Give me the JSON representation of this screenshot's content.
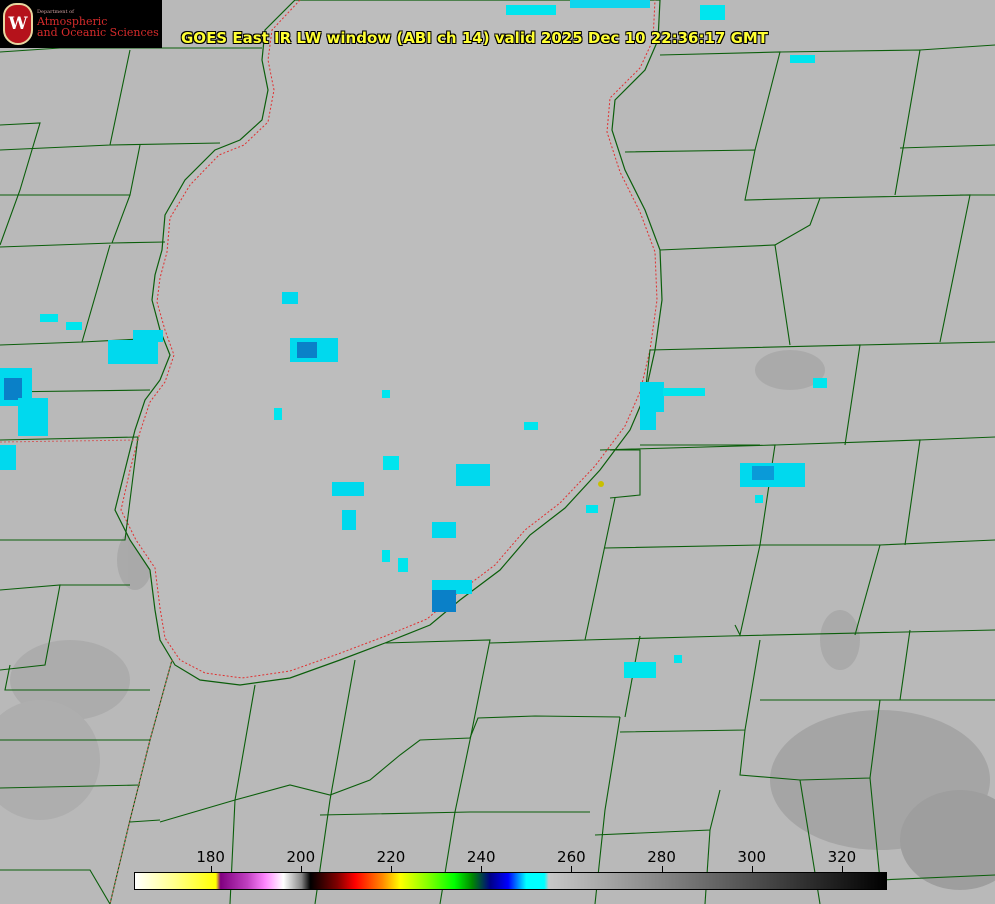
{
  "title": "GOES East IR LW window (ABI ch 14) valid 2025 Dec 10 22:36:17 GMT",
  "logo": {
    "seal_letter": "W",
    "department": "Department of",
    "line1": "Atmospheric",
    "line2": "and Oceanic Sciences"
  },
  "colorbar": {
    "ticks": [
      "180",
      "200",
      "220",
      "240",
      "260",
      "280",
      "300",
      "320"
    ],
    "tick_values": [
      180,
      200,
      220,
      240,
      260,
      280,
      300,
      320
    ],
    "range": [
      163,
      330
    ]
  },
  "colors": {
    "land": "#b9b9b9",
    "lake": "#bcbcbc",
    "county_lines": "#0b5e0b",
    "coastline": "#0b5e0b",
    "lake_dotted": "#e03030",
    "cold_cloud_cyan": "#00e5ee",
    "cold_cloud_blue": "#0a8fd0",
    "title_text": "#ffff33"
  }
}
